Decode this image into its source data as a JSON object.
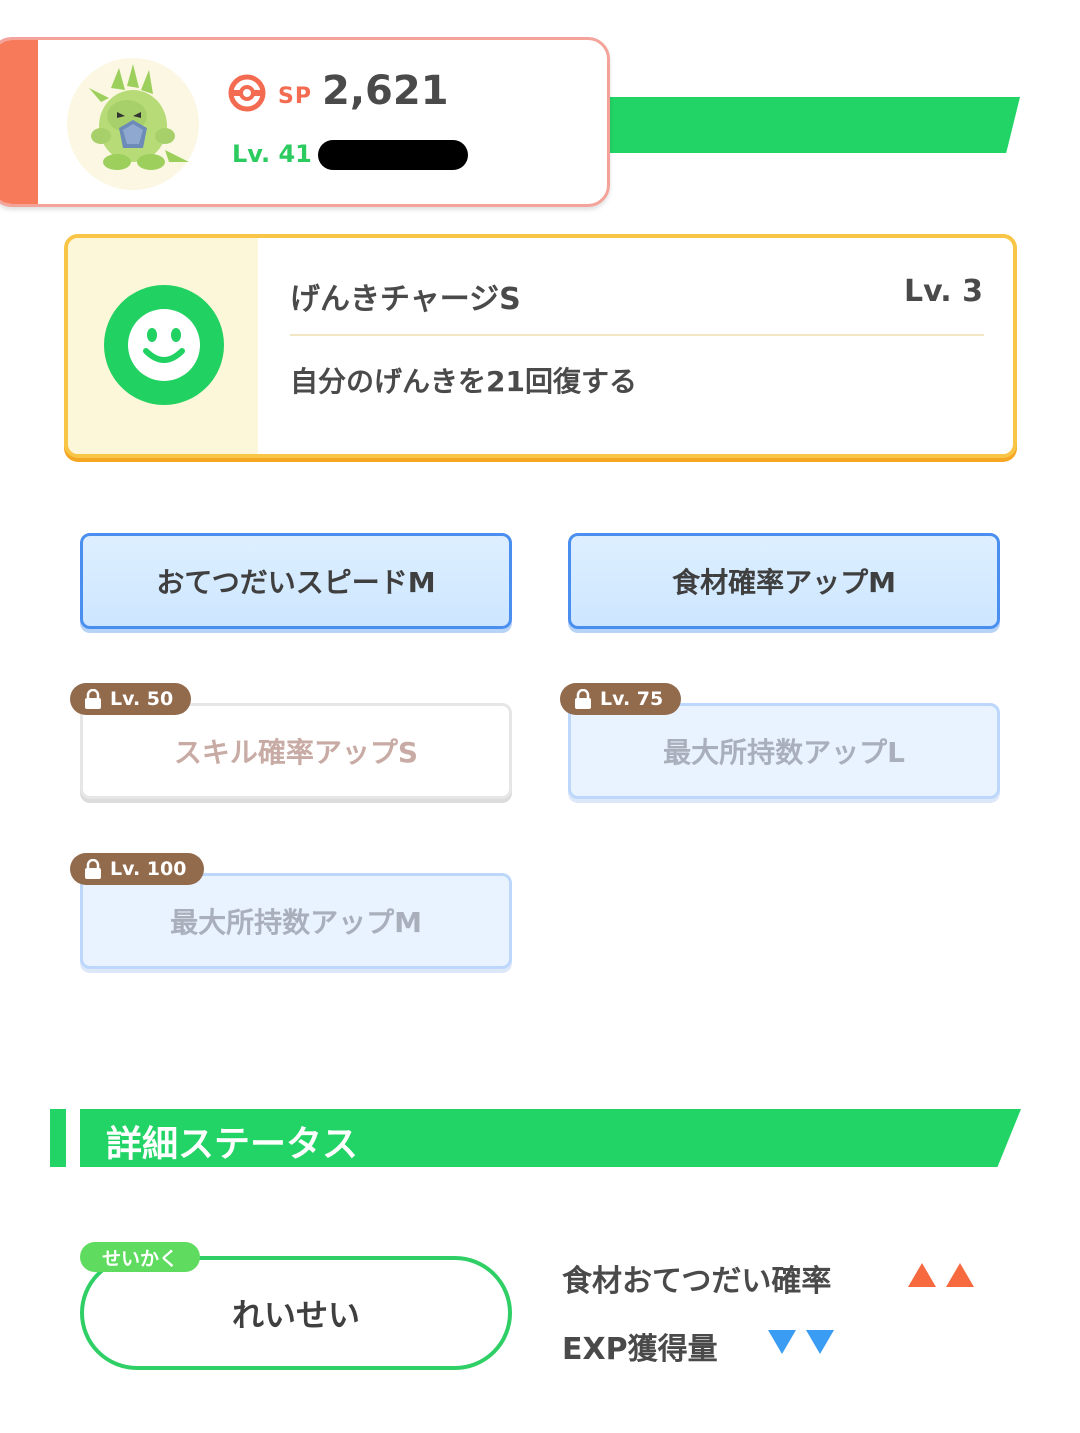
{
  "header": {
    "sp_label": "SP",
    "sp_value": "2,621",
    "level_label": "Lv. 41",
    "pokemon_icon": "tyranitar-icon",
    "sp_icon": "pokeball-icon",
    "colors": {
      "accent": "#f77a5b",
      "banner": "#22d466",
      "level": "#2ccb60"
    }
  },
  "main_skill": {
    "name": "げんきチャージS",
    "level": "Lv. 3",
    "description": "自分のげんきを21回復する",
    "icon": "smiley-icon",
    "colors": {
      "border": "#f8c547",
      "icon_bg": "#21d161"
    }
  },
  "sub_skills": [
    {
      "label": "おてつだいスピードM",
      "lock": ""
    },
    {
      "label": "食材確率アップM",
      "lock": ""
    },
    {
      "label": "スキル確率アップS",
      "lock": "Lv. 50"
    },
    {
      "label": "最大所持数アップL",
      "lock": "Lv. 75"
    },
    {
      "label": "最大所持数アップM",
      "lock": "Lv. 100"
    }
  ],
  "detail_status": {
    "title": "詳細ステータス",
    "nature_tag": "せいかく",
    "nature_value": "れいせい",
    "effects": [
      {
        "label": "食材おてつだい確率",
        "direction": "up",
        "color": "#f76a3f"
      },
      {
        "label": "EXP獲得量",
        "direction": "down",
        "color": "#3a9cf2"
      }
    ]
  }
}
